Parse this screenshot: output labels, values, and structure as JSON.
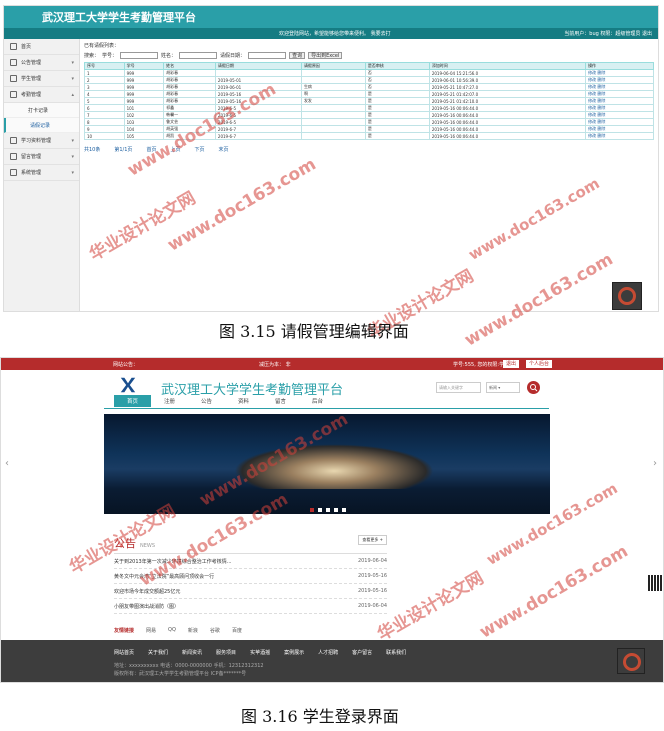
{
  "fig1": {
    "system_title": "武汉理工大学学生考勤管理平台",
    "welcome_text": "欢迎登陆网站，希望能够给您带来便利。    我要去打",
    "user_text": "当前用户：bug 权限：超级管理员 退出",
    "sidebar": {
      "items": [
        {
          "label": "首页"
        },
        {
          "label": "公告管理"
        },
        {
          "label": "学生管理"
        },
        {
          "label": "考勤管理"
        }
      ],
      "sub_items": [
        {
          "label": "打卡记录"
        },
        {
          "label": "请假记录"
        }
      ],
      "items_after": [
        {
          "label": "学习资料管理"
        },
        {
          "label": "留言管理"
        },
        {
          "label": "系统管理"
        }
      ]
    },
    "location": "已有请假列表：",
    "search": {
      "label": "搜索：",
      "f1": "学号：",
      "f2": "姓名：",
      "f3": "请假日期：",
      "btn1": "查询",
      "btn2": "导出到Excel"
    },
    "table": {
      "headers": [
        "序号",
        "学号",
        "姓名",
        "请假日期",
        "请假原因",
        "是否审核",
        "添加时间",
        "操作"
      ],
      "rows": [
        [
          "1",
          "999",
          "胡彩春",
          "",
          "",
          "否",
          "2019-06-04 15:21:56.0",
          "修改 删除"
        ],
        [
          "2",
          "999",
          "胡彩春",
          "2019-05-01",
          "",
          "否",
          "2019-06-01 10:56:39.0",
          "修改 删除"
        ],
        [
          "3",
          "999",
          "胡彩春",
          "2019-06-01",
          "生病",
          "否",
          "2019-05-21 10:47:27.0",
          "修改 删除"
        ],
        [
          "4",
          "999",
          "胡彩春",
          "2019-05-16",
          "啊",
          "是",
          "2019-05-21 01:42:07.0",
          "修改 删除"
        ],
        [
          "5",
          "999",
          "胡彩春",
          "2019-05-16",
          "发发",
          "是",
          "2019-05-21 01:42:10.0",
          "修改 删除"
        ],
        [
          "6",
          "101",
          "祁鑫",
          "2019-6-5",
          "",
          "是",
          "2019-05-16 00:06:44.0",
          "修改 删除"
        ],
        [
          "7",
          "102",
          "韩馨一",
          "2019-6-5",
          "",
          "是",
          "2019-05-16 00:06:44.0",
          "修改 删除"
        ],
        [
          "8",
          "103",
          "鲁文芸",
          "2019-6-5",
          "",
          "是",
          "2019-05-16 00:06:44.0",
          "修改 删除"
        ],
        [
          "9",
          "104",
          "胡英强",
          "2019-6-7",
          "",
          "是",
          "2019-05-16 00:06:44.0",
          "修改 删除"
        ],
        [
          "10",
          "105",
          "胡凯",
          "2019-6-7",
          "",
          "是",
          "2019-05-16 00:06:44.0",
          "修改 删除"
        ]
      ]
    },
    "pager": [
      "共10条",
      "第1/1页",
      "首页",
      "上页",
      "下页",
      "末页"
    ],
    "caption": "图 3.15 请假管理编辑界面"
  },
  "fig2": {
    "topbar": {
      "left": "网站公告：",
      "center": "减压为本：  非",
      "right": "学号:555, 您的权限:学生",
      "btn1": "退出",
      "btn2": "个人后台"
    },
    "title": "武汉理工大学学生考勤管理平台",
    "search_placeholder": "请输入关键字",
    "select_value": "新闻",
    "nav": [
      "首页",
      "注册",
      "公告",
      "资料",
      "留言",
      "后台"
    ],
    "news": {
      "title": "公告",
      "title_en": "NEWS",
      "more": "查看更多 +",
      "items": [
        {
          "text": "关于到2013年第一次减少环境综合整治工作考核情...",
          "date": "2019-06-04"
        },
        {
          "text": "黄冬文中元会湾“立法院”最高顾问顶收会一行",
          "date": "2019-05-16"
        },
        {
          "text": "欢迎市场今年成交额超25亿元",
          "date": "2019-05-16"
        },
        {
          "text": "小朋友带图演出战消防（图）",
          "date": "2019-06-04"
        }
      ]
    },
    "links": [
      "友情链接",
      "网易",
      "QQ",
      "新浪",
      "谷歌",
      "百度"
    ],
    "footer": {
      "nav": [
        "网站首页",
        "关于我们",
        "新闻资讯",
        "服务项目",
        "实苹酒摇",
        "案例展示",
        "人才招聘",
        "客户留言",
        "联系我们"
      ],
      "line1": "地址：xxxxxxxxxx    电话：0000-0000000    手机：12312312312",
      "line2": "版权所有：武汉理工大学学生考勤管理平台    ICP备*******号"
    },
    "caption": "图 3.16 学生登录界面"
  },
  "watermarks": [
    "华业设计论文网",
    "www.doc163.com"
  ]
}
